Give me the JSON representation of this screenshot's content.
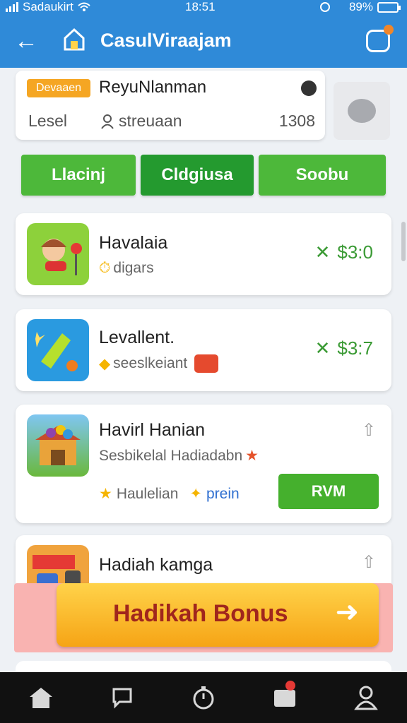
{
  "status": {
    "carrier": "Sadaukirt",
    "time": "18:51",
    "battery": "89%"
  },
  "app": {
    "title": "CasulViraajam"
  },
  "profile": {
    "badge": "Devaaen",
    "name": "ReyuNlanman",
    "level": "Lesel",
    "user": "streuaan",
    "points": "1308"
  },
  "tabs": [
    {
      "label": "Llacinj"
    },
    {
      "label": "Cldgiusa"
    },
    {
      "label": "Soobu"
    }
  ],
  "items": [
    {
      "title": "Havalaia",
      "subtitle": "digars",
      "price": "$3:0"
    },
    {
      "title": "Levallent.",
      "subtitle": "seeslkeiant",
      "price": "$3:7"
    },
    {
      "title": "Havirl Hanian",
      "subtitle": "Sesbikelal Hadiadabn",
      "tag1": "Haulelian",
      "tag2": "prein",
      "action": "RVM"
    },
    {
      "title": "Hadiah kamga"
    }
  ],
  "bonus": {
    "label": "Hadikah Bonus"
  },
  "icons": {
    "home": "home-icon",
    "chat": "chat-icon",
    "timer": "timer-icon",
    "store": "store-icon",
    "profile": "profile-icon"
  },
  "colors": {
    "primary": "#2f8ad8",
    "accent_green": "#4db83a",
    "bonus": "#f6a415"
  }
}
